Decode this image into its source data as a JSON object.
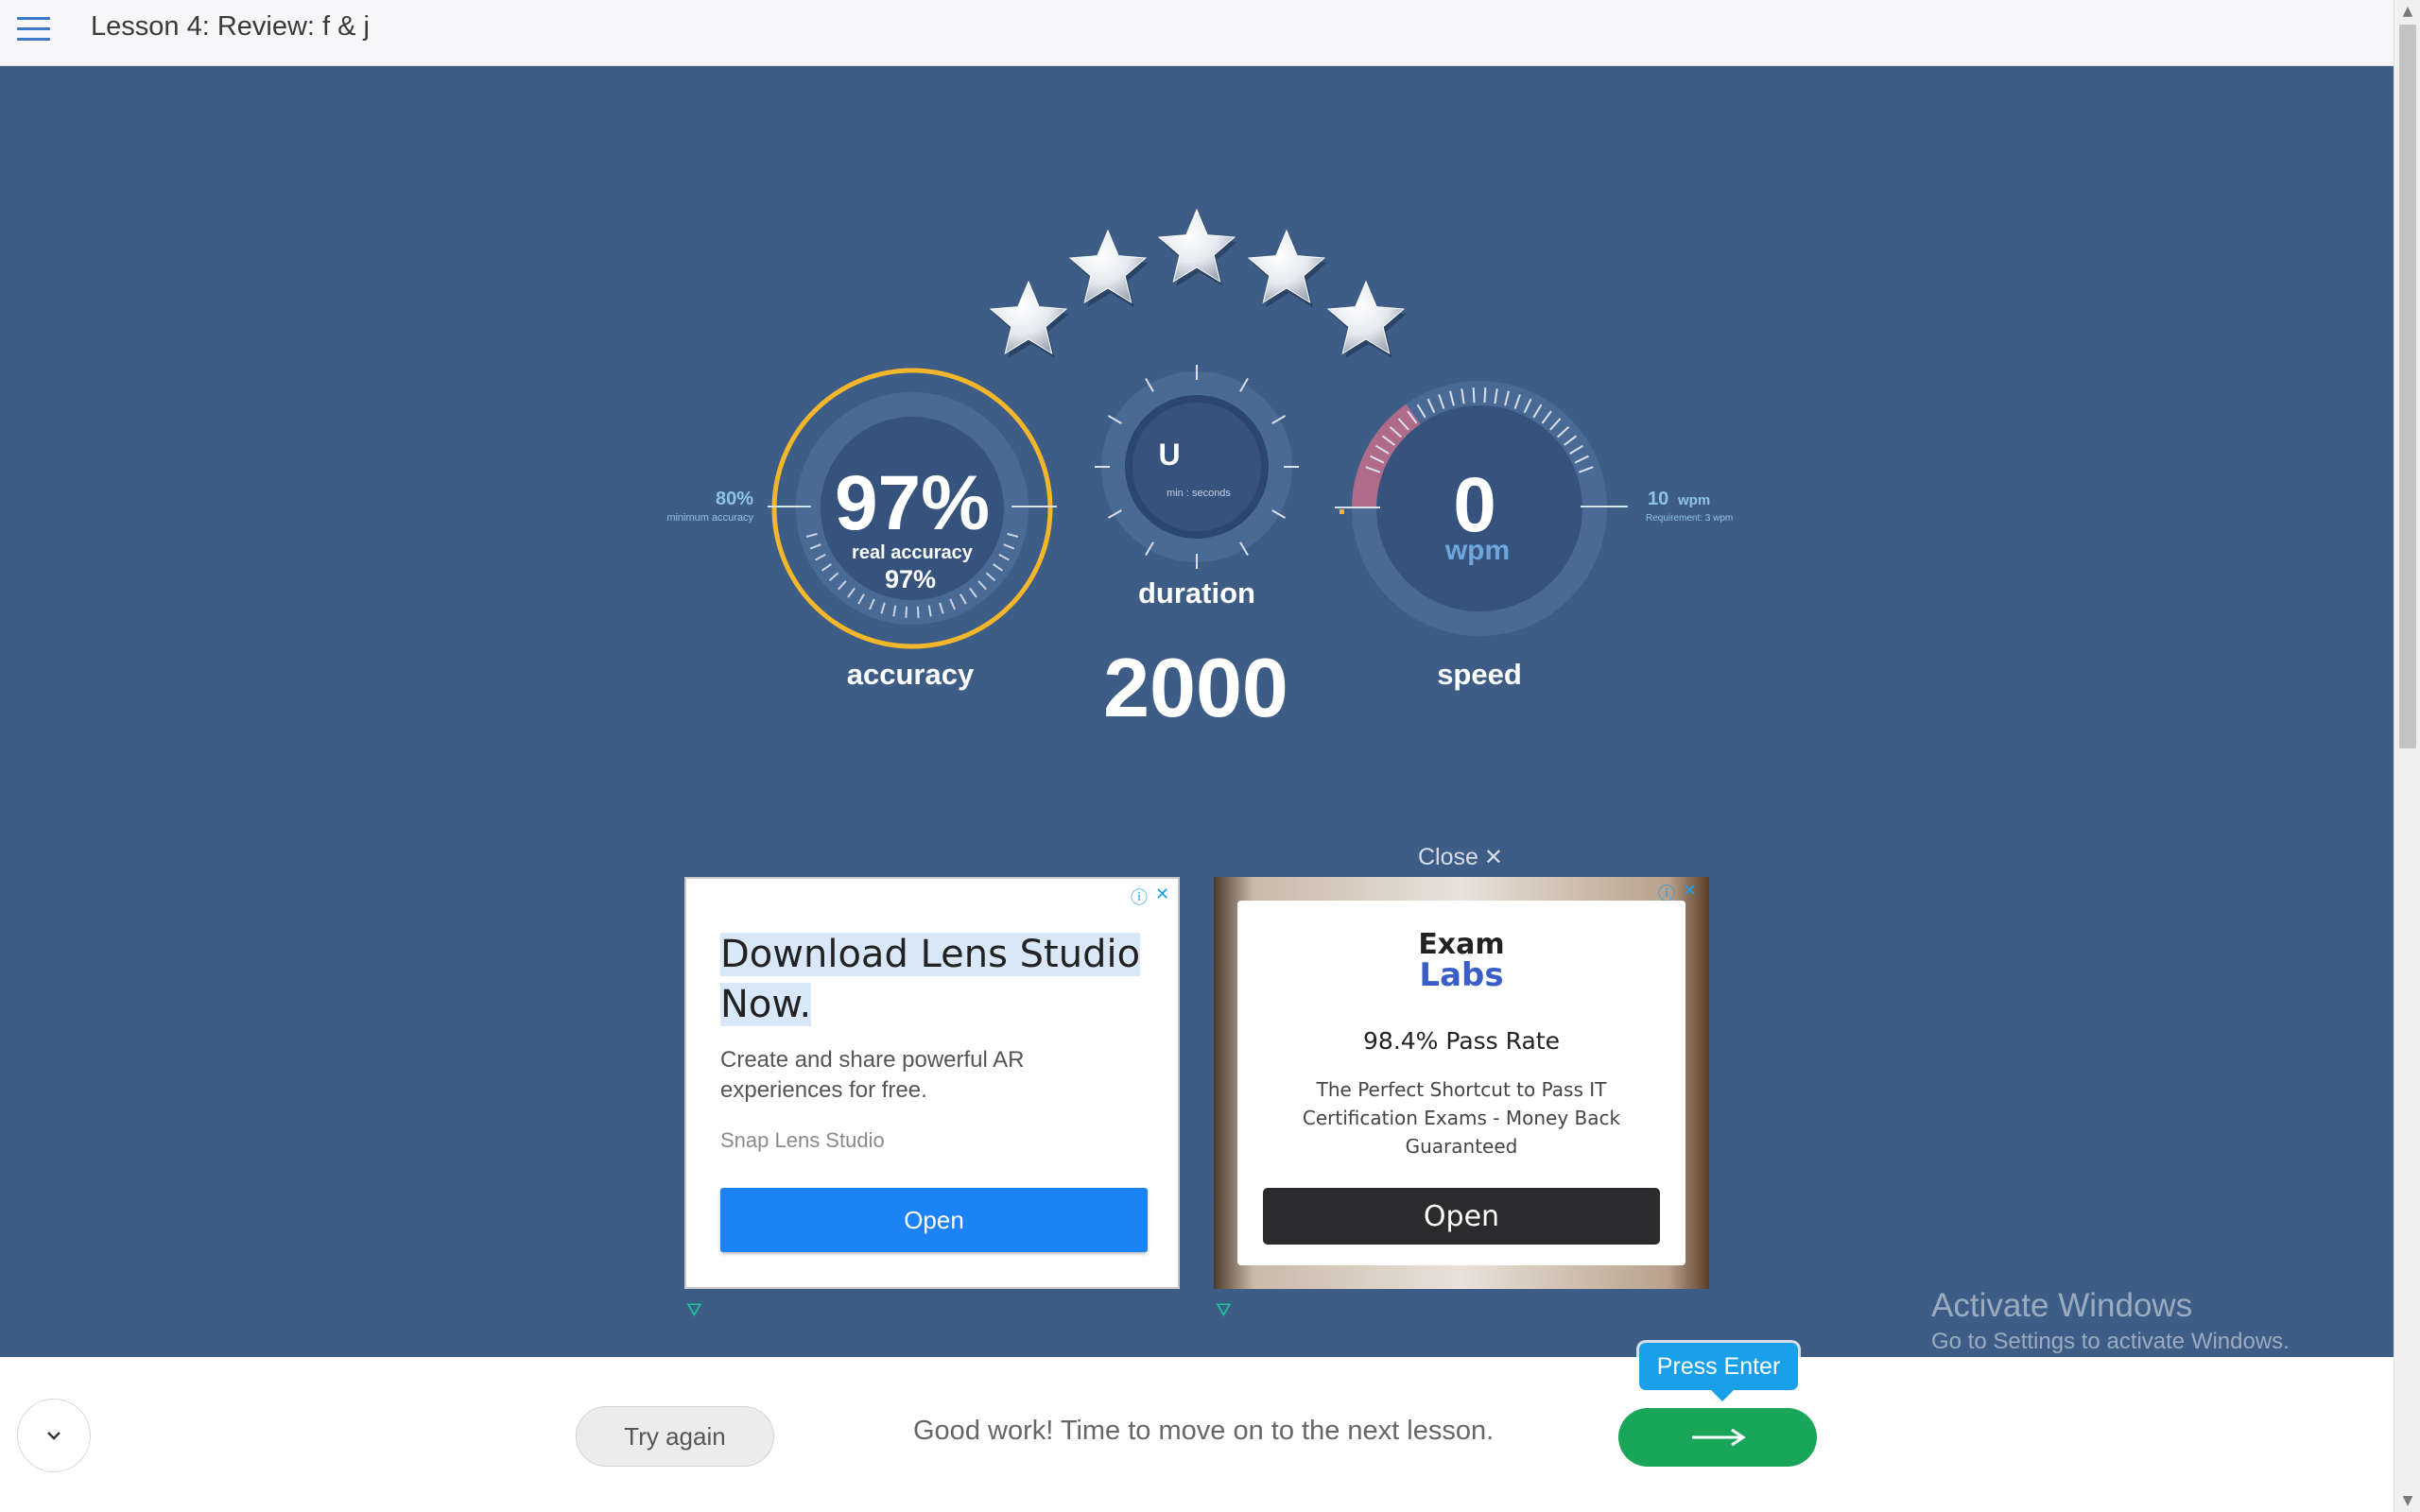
{
  "header": {
    "title": "Lesson 4: Review: f & j"
  },
  "stars": {
    "earned": 5,
    "total": 5
  },
  "accuracy": {
    "value": "97%",
    "real_label": "real accuracy",
    "real_value": "97%",
    "label": "accuracy",
    "min_value": "80%",
    "min_label": "minimum accuracy",
    "fraction": 0.97,
    "color": "#f4b62a"
  },
  "duration": {
    "unit_value": "U",
    "unit_label": "min : seconds",
    "label": "duration",
    "value": "2000"
  },
  "speed": {
    "value": "0",
    "unit": "wpm",
    "label": "speed",
    "target_value": "10",
    "target_unit": "wpm",
    "requirement": "Requirement: 3 wpm"
  },
  "ads": {
    "close_label": "Close",
    "ad1": {
      "headline_line1": "Download Lens Studio",
      "headline_line2": "Now.",
      "body": "Create and share powerful AR experiences for free.",
      "advertiser": "Snap Lens Studio",
      "cta": "Open"
    },
    "ad2": {
      "brand_line1": "Exam",
      "brand_line2": "Labs",
      "headline": "98.4% Pass Rate",
      "body": "The Perfect Shortcut to Pass IT Certification Exams - Money Back Guaranteed",
      "cta": "Open"
    }
  },
  "watermark": {
    "line1": "Activate Windows",
    "line2": "Go to Settings to activate Windows."
  },
  "footer": {
    "try_again": "Try again",
    "message": "Good work! Time to move on to the next lesson.",
    "tooltip": "Press Enter"
  },
  "colors": {
    "background": "#3e5d86",
    "accent_yellow": "#f4b62a",
    "next_green": "#19a65a",
    "tooltip_blue": "#1aa0e8",
    "ad_button_blue": "#1b82f7"
  }
}
